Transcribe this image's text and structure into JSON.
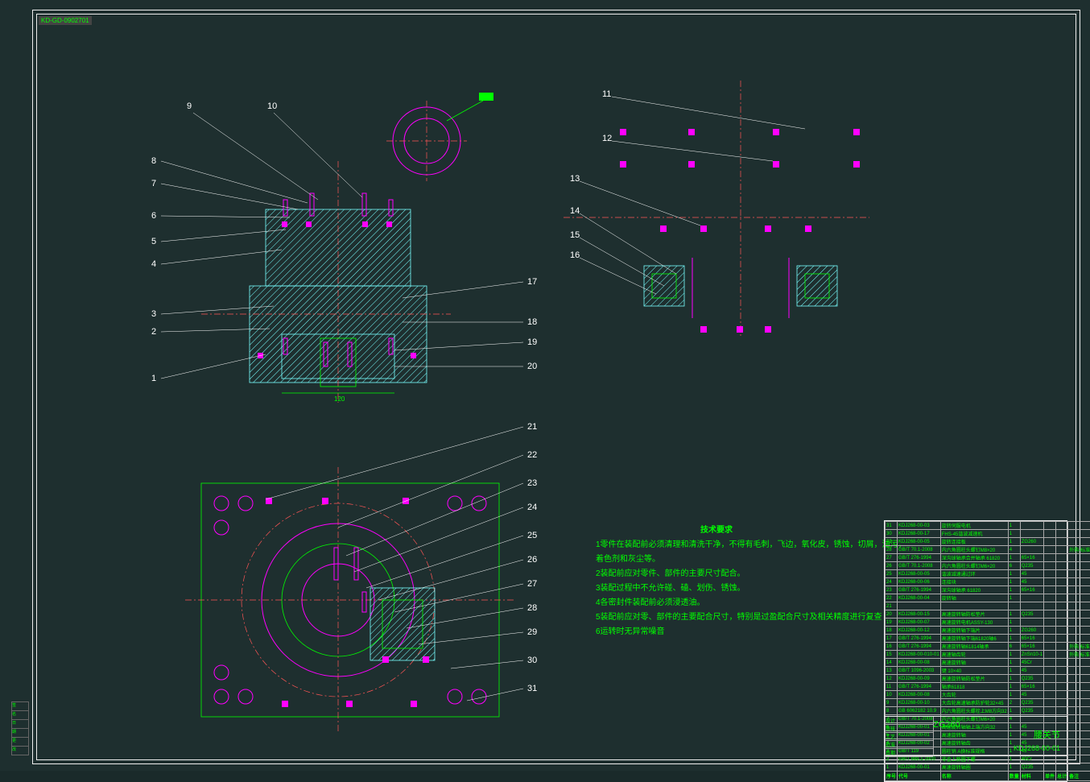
{
  "doc_tag": "KD-GD-0902701",
  "tech_req": {
    "title": "技术要求",
    "lines": [
      "1零件在装配前必须清理和清洗干净，不得有毛刺，飞边，氧化皮，锈蚀，切屑，油污，",
      "着色剂和灰尘等。",
      "2装配前应对零件、部件的主要尺寸配合。",
      "3装配过程中不允许碰、磕、划伤、锈蚀。",
      "4各密封件装配前必须浸透油。",
      "5装配前应对零、部件的主要配合尺寸，特别是过盈配合尺寸及相关精度进行复查",
      "6运转时无异常噪音"
    ]
  },
  "balloons": {
    "left": [
      "1",
      "2",
      "3",
      "4",
      "5",
      "6",
      "7",
      "8",
      "9",
      "10"
    ],
    "mid": [
      "17",
      "18",
      "19",
      "20"
    ],
    "right": [
      "11",
      "12",
      "13",
      "14",
      "15",
      "16"
    ],
    "bottom": [
      "21",
      "22",
      "23",
      "24",
      "25",
      "26",
      "27",
      "28",
      "29",
      "30",
      "31"
    ]
  },
  "bom_header": [
    "序号",
    "代号",
    "名称",
    "数量",
    "材料",
    "单件",
    "总计",
    "备注"
  ],
  "bom": [
    [
      "31",
      "KDJ268-00-03",
      "旋转伺服电机",
      "1",
      "",
      "",
      "",
      ""
    ],
    [
      "30",
      "KDJ268-00-17",
      "FHS-45谐波减速机",
      "1",
      "",
      "",
      "",
      ""
    ],
    [
      "29",
      "KDJ268-00-05",
      "旋转连接板",
      "1",
      "ZG260",
      "",
      "",
      ""
    ],
    [
      "28",
      "GB/T 70.1-2008",
      "内六角圆柱头螺钉M8×20",
      "4",
      "",
      "",
      "",
      "外购-标准"
    ],
    [
      "27",
      "GB/T 276-1994",
      "深沟球轴承合并轴承 61820",
      "1",
      "65×16",
      "",
      "",
      ""
    ],
    [
      "26",
      "GB/T 70.1-2008",
      "内六角圆柱头螺钉M6×20",
      "6",
      "Q235",
      "",
      "",
      ""
    ],
    [
      "25",
      "KDJ268-00-05",
      "谐波减速通过环",
      "1",
      "45",
      "",
      "",
      ""
    ],
    [
      "24",
      "KDJ268-00-06",
      "连接块",
      "1",
      "45",
      "",
      "",
      ""
    ],
    [
      "23",
      "GB/T 276-1994",
      "深沟球轴承 61820",
      "1",
      "65×16",
      "",
      "",
      ""
    ],
    [
      "22",
      "KDJ268-00-04",
      "旋转轴",
      "1",
      "",
      "",
      "",
      ""
    ],
    [
      "21",
      "",
      "",
      "",
      "",
      "",
      "",
      ""
    ],
    [
      "20",
      "KDJ268-00-15",
      "高速旋转轴防松垫片",
      "1",
      "Q235",
      "",
      "",
      ""
    ],
    [
      "19",
      "KDJ268-00-07",
      "高速旋转电机ASSY-130",
      "1",
      "",
      "",
      "",
      ""
    ],
    [
      "18",
      "KDJ268-00-12",
      "高速旋转轴下端片",
      "1",
      "ZG260",
      "",
      "",
      ""
    ],
    [
      "17",
      "GB/T 276-1994",
      "高速旋转轴下端61820轴6",
      "1",
      "65×16",
      "",
      "",
      ""
    ],
    [
      "16",
      "GB/T 276-1994",
      "高速旋转轴61814轴承",
      "6",
      "65×16",
      "",
      "",
      "外购 标准件"
    ],
    [
      "15",
      "KDJ268-00-010-01",
      "高速轴齿轮",
      "1",
      "ZnSn10-1",
      "",
      "",
      "外购 标准件"
    ],
    [
      "14",
      "KDJ268-00-08",
      "高速旋转轴",
      "1",
      "45Cr",
      "",
      "",
      ""
    ],
    [
      "13",
      "GB/T 1096-2003",
      "键 10×40",
      "1",
      "45",
      "",
      "",
      ""
    ],
    [
      "12",
      "KDJ268-00-09",
      "高速旋转轴防松垫片",
      "1",
      "Q235",
      "",
      "",
      ""
    ],
    [
      "11",
      "GB/T 276-1994",
      "轴承61818",
      "1",
      "65×16",
      "",
      "",
      ""
    ],
    [
      "10",
      "KDJ268-00-08",
      "大齿轮",
      "1",
      "45",
      "",
      "",
      ""
    ],
    [
      "9",
      "KDJ268-00-10",
      "大齿轮高速轴承防护轮32×45",
      "2",
      "Q235",
      "",
      "",
      ""
    ],
    [
      "8",
      "GB 6062182 10.9",
      "内六角圆柱头螺栓上M8方向32",
      "1",
      "Q235",
      "",
      "",
      ""
    ],
    [
      "7",
      "GB/T 70.1-2008",
      "内六角圆柱头螺钉M6×20",
      "4",
      "",
      "",
      "",
      ""
    ],
    [
      "6",
      "KDJ268-00-01",
      "高速旋转轴轴上端方向32",
      "1",
      "45",
      "",
      "",
      ""
    ],
    [
      "5",
      "KDJ268-00-01",
      "高速旋转轴",
      "1",
      "45",
      "",
      "",
      ""
    ],
    [
      "4",
      "KDJ268-00-02",
      "高速旋转轴齿",
      "1",
      "45",
      "",
      "",
      ""
    ],
    [
      "3",
      "GB/T 119",
      "圆柱销 A换标准规格",
      "1",
      "45",
      "",
      "",
      ""
    ],
    [
      "2",
      "GB/T 889.1-2000",
      "非金上新圆下螺",
      "1",
      "40Cr",
      "",
      "",
      ""
    ],
    [
      "1",
      "KDJ268-00-01",
      "高速旋转轴圈",
      "1",
      "Q235",
      "",
      "",
      ""
    ]
  ],
  "title_block": {
    "project": "ZG260",
    "name": "腰关节",
    "code": "KDJ268-00-01",
    "rows": [
      "设计",
      "审核",
      "工艺",
      "批准",
      "日期"
    ]
  },
  "side_tabs": [
    "签",
    "名",
    "日",
    "期",
    "更",
    "改"
  ]
}
